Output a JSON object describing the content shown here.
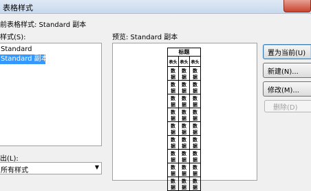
{
  "window": {
    "title": "表格样式"
  },
  "current_style": {
    "label": "前表格样式: Standard 副本"
  },
  "styles": {
    "label": "样式(S):",
    "items": [
      {
        "label": "Standard",
        "selected": false
      },
      {
        "label": "Standard 副本",
        "selected": true
      }
    ]
  },
  "list_filter": {
    "label": "出(L):",
    "value": "所有样式"
  },
  "preview": {
    "label": "预览: Standard 副本",
    "table": {
      "title": "标题",
      "headers": [
        "表头",
        "表头",
        "表头"
      ],
      "rows": [
        [
          "数据",
          "数据",
          "数据"
        ],
        [
          "数据",
          "数据",
          "数据"
        ],
        [
          "数据",
          "数据",
          "数据"
        ],
        [
          "数据",
          "数据",
          "数据"
        ],
        [
          "数据",
          "数据",
          "数据"
        ],
        [
          "数据",
          "数据",
          "数据"
        ],
        [
          "数据",
          "数据",
          "数据"
        ],
        [
          "数据",
          "数据",
          "数据"
        ],
        [
          "数据",
          "数据",
          "数据"
        ]
      ]
    }
  },
  "buttons": {
    "set_current": "置为当前(U)",
    "new": "新建(N)...",
    "modify": "修改(M)...",
    "delete": "删除(D)"
  },
  "colors": {
    "selection": "#3399ff",
    "titlebar": "#dfe9f5",
    "close_button": "#c8432d"
  }
}
